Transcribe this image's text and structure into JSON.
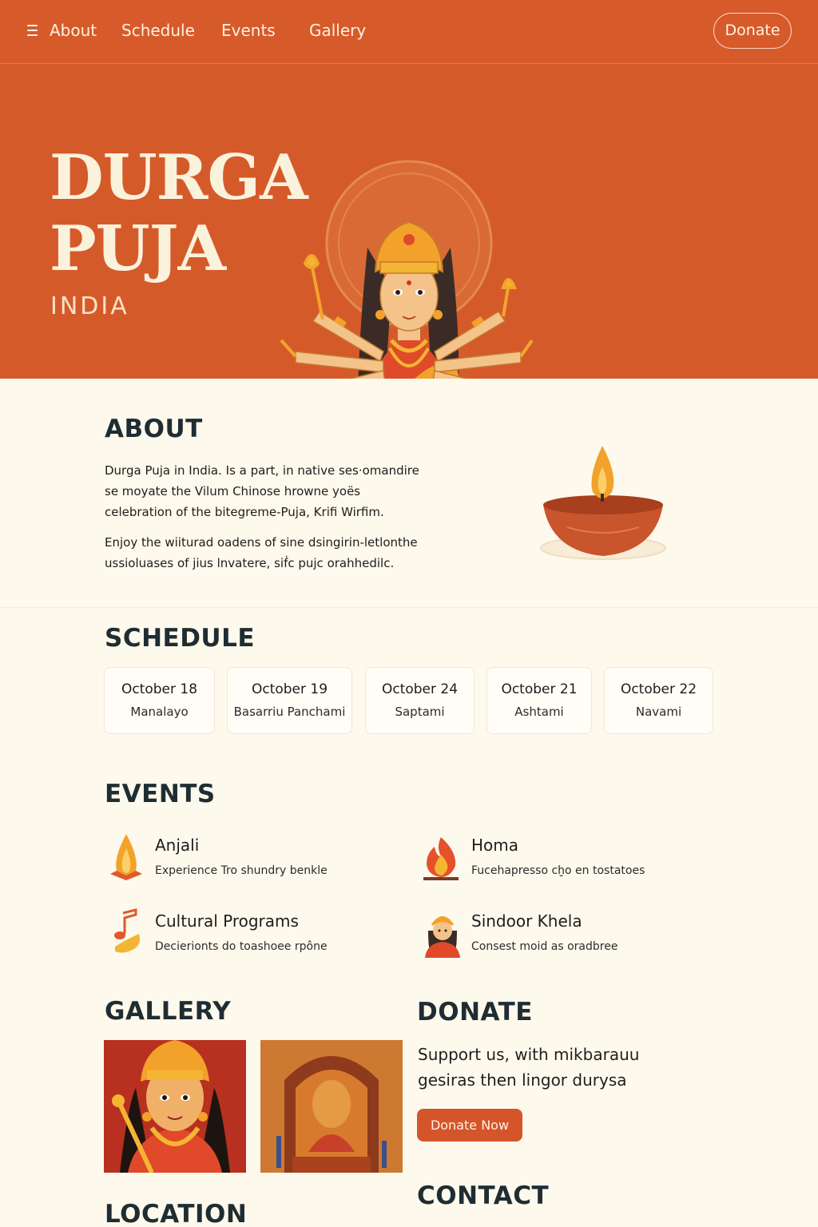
{
  "nav": {
    "links": [
      "About",
      "Schedule",
      "Events",
      "Gallery"
    ],
    "donate_label": "Donate"
  },
  "hero": {
    "title_line1": "DURGA",
    "title_line2": "PUJA",
    "subtitle": "INDIA"
  },
  "about": {
    "heading": "ABOUT",
    "paragraph1": "Durga Puja in India. Is a part, in native ses·omandire se moyate the Vilum Chinose hrowne yoës celebration of the bitegreme-Puja, Krifi Wirfim.",
    "paragraph2": "Enjoy the wiiturad oadens of sine dsingirin-letlonthe ussioluases of jius lnvatere, siḟc pujc orahhedilc."
  },
  "schedule": {
    "heading": "SCHEDULE",
    "items": [
      {
        "date": "October 18",
        "day": "Manalayo"
      },
      {
        "date": "October 19",
        "day": "Basarriu Panchami"
      },
      {
        "date": "October 24",
        "day": "Saptami"
      },
      {
        "date": "October 21",
        "day": "Ashtami"
      },
      {
        "date": "October 22",
        "day": "Navami"
      }
    ]
  },
  "events": {
    "heading": "EVENTS",
    "items": [
      {
        "title": "Anjali",
        "desc": "Experience Tro shundry benkle",
        "icon": "flame-offering-icon"
      },
      {
        "title": "Homa",
        "desc": "Fucehapresso cḫo en tostatoes",
        "icon": "fire-icon"
      },
      {
        "title": "Cultural Programs",
        "desc": "Decierionts do toashoee rpône",
        "icon": "music-note-icon"
      },
      {
        "title": "Sindoor Khela",
        "desc": "Consest moid as oradbree",
        "icon": "woman-icon"
      }
    ]
  },
  "gallery": {
    "heading": "GALLERY"
  },
  "donate": {
    "heading": "DONATE",
    "text": "Support us, with mikbarauu gesiras then lingor durysa",
    "button_label": "Donate Now"
  },
  "location": {
    "heading": "LOCATION"
  },
  "contact": {
    "heading": "CONTACT"
  },
  "colors": {
    "brand_orange": "#d75a2b",
    "cream": "#fdf9ec",
    "heading_dark": "#1f2d33"
  }
}
